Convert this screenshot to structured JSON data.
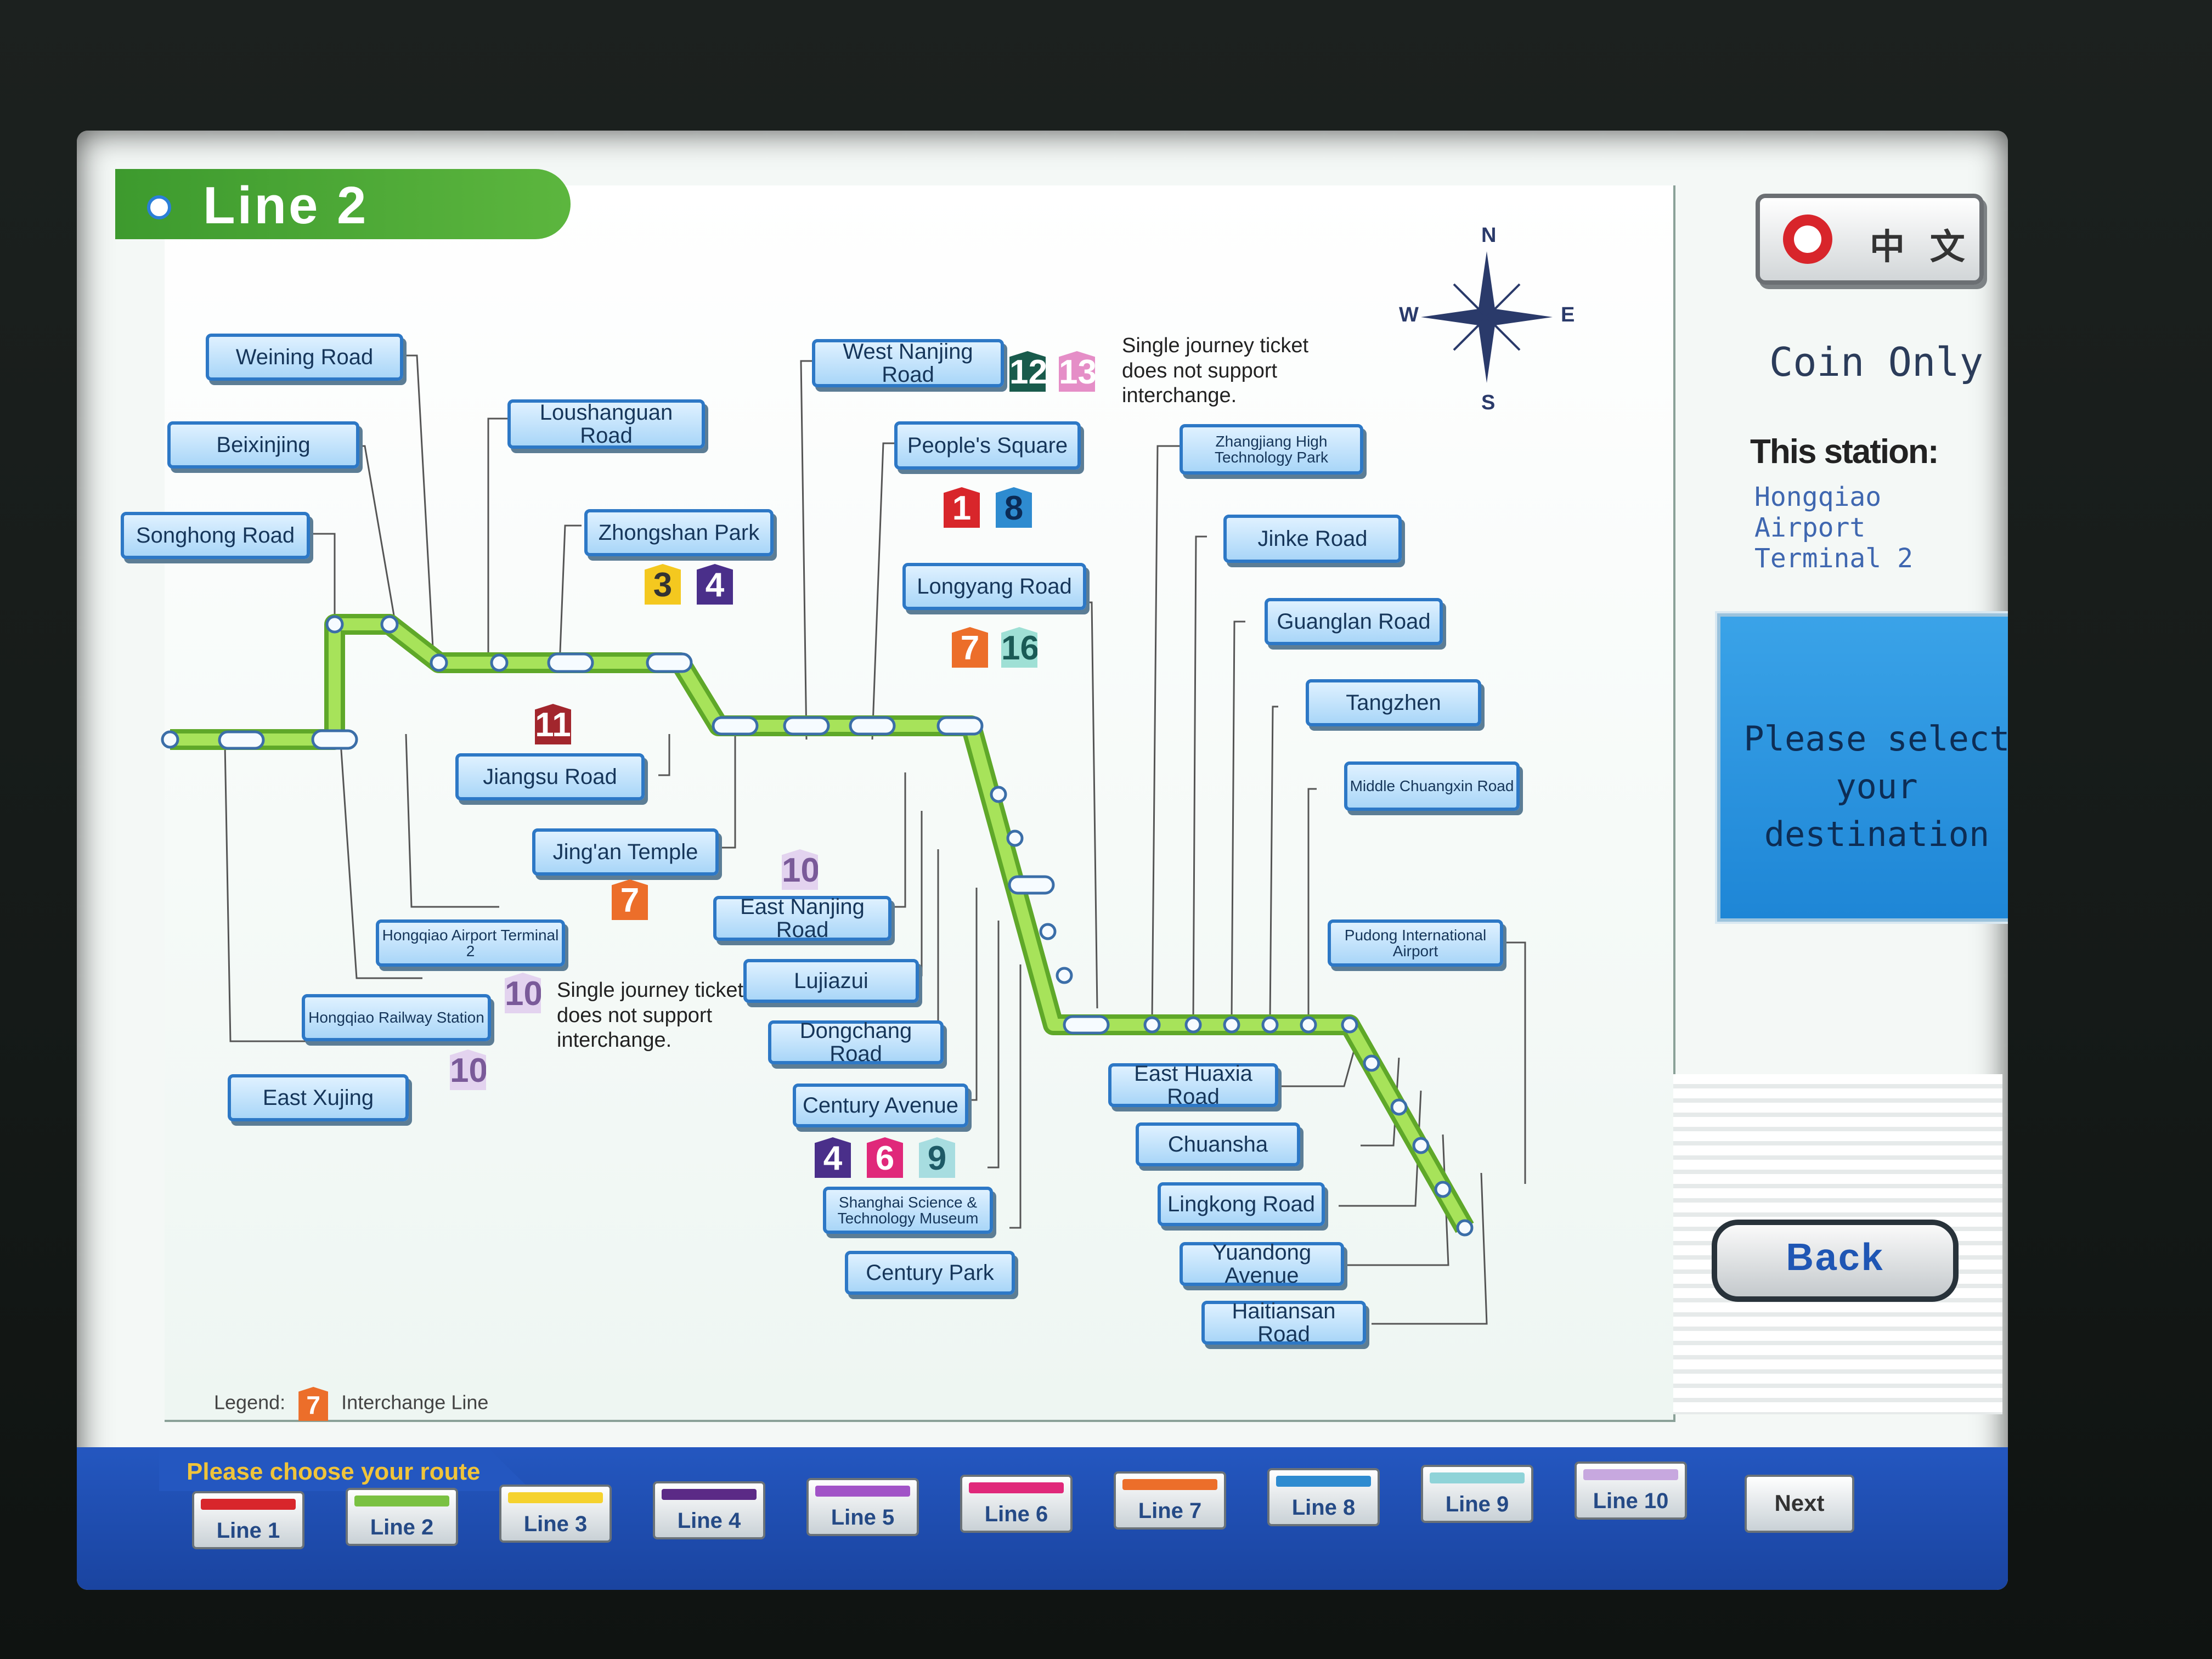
{
  "header": {
    "title": "Line 2"
  },
  "compass": {
    "n": "N",
    "s": "S",
    "e": "E",
    "w": "W"
  },
  "stations": {
    "weining_road": "Weining Road",
    "beixinjing": "Beixinjing",
    "songhong_road": "Songhong Road",
    "loushanguan_road": "Loushanguan Road",
    "zhongshan_park": "Zhongshan Park",
    "west_nanjing_road": "West Nanjing Road",
    "peoples_square": "People's Square",
    "longyang_road": "Longyang Road",
    "zhangjiang": "Zhangjiang High Technology Park",
    "jinke_road": "Jinke Road",
    "guanglan_road": "Guanglan Road",
    "tangzhen": "Tangzhen",
    "middle_chuangxin": "Middle Chuangxin Road",
    "pudong_airport": "Pudong International Airport",
    "jiangsu_road": "Jiangsu Road",
    "jingan_temple": "Jing'an Temple",
    "east_nanjing_road": "East Nanjing Road",
    "lujiazui": "Lujiazui",
    "dongchang_road": "Dongchang Road",
    "century_avenue": "Century Avenue",
    "sstm": "Shanghai Science & Technology Museum",
    "century_park": "Century Park",
    "hongqiao_t2": "Hongqiao Airport Terminal 2",
    "hongqiao_rail": "Hongqiao Railway Station",
    "east_xujing": "East Xujing",
    "east_huaxia": "East Huaxia Road",
    "chuansha": "Chuansha",
    "lingkong": "Lingkong Road",
    "yuandong": "Yuandong Avenue",
    "haitiansan": "Haitiansan Road"
  },
  "badges": {
    "b11": "11",
    "b3": "3",
    "b4a": "4",
    "b12": "12",
    "b13": "13",
    "b1": "1",
    "b8": "8",
    "b7a": "7",
    "b16": "16",
    "b7b": "7",
    "b10a": "10",
    "b10b": "10",
    "b10c": "10",
    "b4b": "4",
    "b6": "6",
    "b9": "9"
  },
  "notes": {
    "interchange_note_east": "Single journey ticket does not support interchange.",
    "interchange_note_west": "Single journey ticket does not support interchange."
  },
  "legend": {
    "label": "Legend:",
    "badge": "7",
    "text": "Interchange Line"
  },
  "sidebar": {
    "language_label": "中 文",
    "coin_only": "Coin Only",
    "this_station_label": "This station:",
    "this_station_value": "Hongqiao Airport Terminal 2",
    "destination_prompt": "Please select your destination",
    "back_label": "Back"
  },
  "route_bar": {
    "prompt": "Please choose your route",
    "lines": [
      {
        "label": "Line 1",
        "color": "#d8262b"
      },
      {
        "label": "Line 2",
        "color": "#7ac142"
      },
      {
        "label": "Line 3",
        "color": "#f5d22e"
      },
      {
        "label": "Line 4",
        "color": "#5b2a86"
      },
      {
        "label": "Line 5",
        "color": "#a153c7"
      },
      {
        "label": "Line 6",
        "color": "#e0287a"
      },
      {
        "label": "Line 7",
        "color": "#ec6e2a"
      },
      {
        "label": "Line 8",
        "color": "#2e8bd0"
      },
      {
        "label": "Line 9",
        "color": "#8fd3d8"
      },
      {
        "label": "Line 10",
        "color": "#c7a8df"
      }
    ],
    "next_label": "Next"
  },
  "colors": {
    "line2": "#8ed43a",
    "line_border": "#5fa829",
    "station_border": "#2d78c6"
  }
}
